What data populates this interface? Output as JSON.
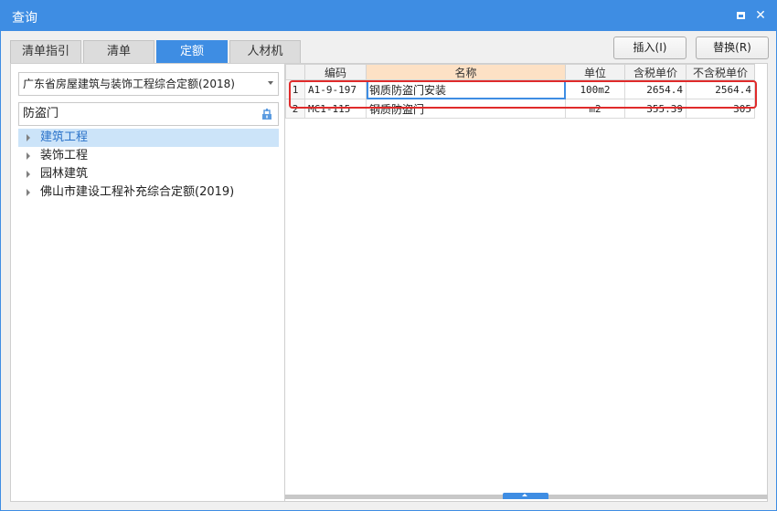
{
  "window": {
    "title": "查询"
  },
  "tabs": [
    {
      "label": "清单指引"
    },
    {
      "label": "清单"
    },
    {
      "label": "定额"
    },
    {
      "label": "人材机"
    }
  ],
  "active_tab": "定额",
  "buttons": {
    "insert": "插入(I)",
    "replace": "替换(R)"
  },
  "library": {
    "selected": "广东省房屋建筑与装饰工程综合定额(2018)"
  },
  "search": {
    "value": "防盗门"
  },
  "tree": [
    {
      "label": "建筑工程",
      "selected": true
    },
    {
      "label": "装饰工程",
      "selected": false
    },
    {
      "label": "园林建筑",
      "selected": false
    },
    {
      "label": "佛山市建设工程补充综合定额(2019)",
      "selected": false
    }
  ],
  "table": {
    "columns": [
      "",
      "编码",
      "名称",
      "单位",
      "含税单价",
      "不含税单价"
    ],
    "rows": [
      {
        "index": "1",
        "code": "A1-9-197",
        "name": "钢质防盗门安装",
        "unit": "100m2",
        "price_tax": "2654.4",
        "price_notax": "2564.4"
      },
      {
        "index": "2",
        "code": "MC1-115",
        "name": "钢质防盗门",
        "unit": "m2",
        "price_tax": "355.39",
        "price_notax": "305"
      }
    ]
  },
  "colors": {
    "accent": "#3e8de3",
    "highlight": "#e02b2b",
    "name_header": "#fde1c5",
    "selected_tree": "#cce4f9"
  },
  "icons": {
    "maximize": "maximize-icon",
    "close": "close-icon",
    "search": "search-icon"
  }
}
